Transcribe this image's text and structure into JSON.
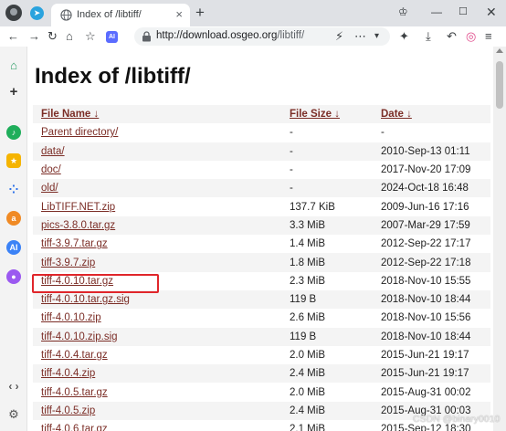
{
  "browser": {
    "tab_title": "Index of /libtiff/",
    "tab_close_glyph": "×",
    "newtab_glyph": "+",
    "url_host": "http://download.osgeo.org",
    "url_path": "/libtiff/",
    "ai_badge": "AI"
  },
  "page": {
    "title": "Index of /libtiff/",
    "headers": {
      "name": "File Name  ↓",
      "size": "File Size  ↓",
      "date": "Date  ↓"
    },
    "rows": [
      {
        "name": "Parent directory/",
        "size": "-",
        "date": "-"
      },
      {
        "name": "data/",
        "size": "-",
        "date": "2010-Sep-13 01:11"
      },
      {
        "name": "doc/",
        "size": "-",
        "date": "2017-Nov-20 17:09"
      },
      {
        "name": "old/",
        "size": "-",
        "date": "2024-Oct-18 16:48"
      },
      {
        "name": "LibTIFF.NET.zip",
        "size": "137.7 KiB",
        "date": "2009-Jun-16 17:16"
      },
      {
        "name": "pics-3.8.0.tar.gz",
        "size": "3.3 MiB",
        "date": "2007-Mar-29 17:59"
      },
      {
        "name": "tiff-3.9.7.tar.gz",
        "size": "1.4 MiB",
        "date": "2012-Sep-22 17:17"
      },
      {
        "name": "tiff-3.9.7.zip",
        "size": "1.8 MiB",
        "date": "2012-Sep-22 17:18"
      },
      {
        "name": "tiff-4.0.10.tar.gz",
        "size": "2.3 MiB",
        "date": "2018-Nov-10 15:55"
      },
      {
        "name": "tiff-4.0.10.tar.gz.sig",
        "size": "119 B",
        "date": "2018-Nov-10 18:44"
      },
      {
        "name": "tiff-4.0.10.zip",
        "size": "2.6 MiB",
        "date": "2018-Nov-10 15:56"
      },
      {
        "name": "tiff-4.0.10.zip.sig",
        "size": "119 B",
        "date": "2018-Nov-10 18:44"
      },
      {
        "name": "tiff-4.0.4.tar.gz",
        "size": "2.0 MiB",
        "date": "2015-Jun-21 19:17"
      },
      {
        "name": "tiff-4.0.4.zip",
        "size": "2.4 MiB",
        "date": "2015-Jun-21 19:17"
      },
      {
        "name": "tiff-4.0.5.tar.gz",
        "size": "2.0 MiB",
        "date": "2015-Aug-31 00:02"
      },
      {
        "name": "tiff-4.0.5.zip",
        "size": "2.4 MiB",
        "date": "2015-Aug-31 00:03"
      },
      {
        "name": "tiff-4.0.6.tar.gz",
        "size": "2.1 MiB",
        "date": "2015-Sep-12 18:30"
      }
    ],
    "highlighted_row": "tiff-4.0.10.tar.gz",
    "highlight_color": "#e0262b",
    "link_color": "#7b2d26"
  },
  "watermark": "CSDN @binary0010"
}
